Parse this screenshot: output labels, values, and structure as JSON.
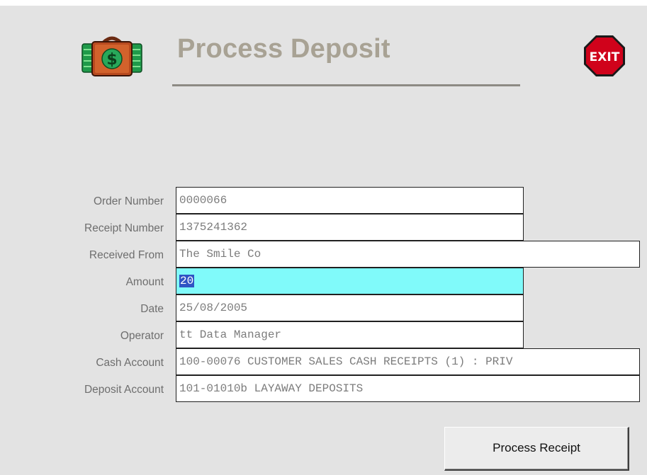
{
  "window": {
    "title": "Process Deposit"
  },
  "header": {
    "logo_icon": "money-bag-dollar-icon",
    "exit_icon": "exit-stop-sign-icon",
    "exit_label": "EXIT"
  },
  "form": {
    "fields": [
      {
        "label": "Order Number",
        "value": "0000066"
      },
      {
        "label": "Receipt Number",
        "value": "1375241362"
      },
      {
        "label": "Received From",
        "value": "The Smile Co"
      },
      {
        "label": "Amount",
        "value": "20"
      },
      {
        "label": "Date",
        "value": "25/08/2005"
      },
      {
        "label": "Operator",
        "value": "tt Data Manager"
      },
      {
        "label": "Cash Account",
        "value": "100-00076 CUSTOMER SALES CASH RECEIPTS (1) : PRIV"
      },
      {
        "label": "Deposit Account",
        "value": "101-01010b LAYAWAY DEPOSITS"
      }
    ]
  },
  "actions": {
    "process_label": "Process Receipt"
  },
  "colors": {
    "title": "#a8a294",
    "active_field": "#80fafa",
    "selection": "#2f53c4",
    "exit_red": "#d0021b"
  }
}
